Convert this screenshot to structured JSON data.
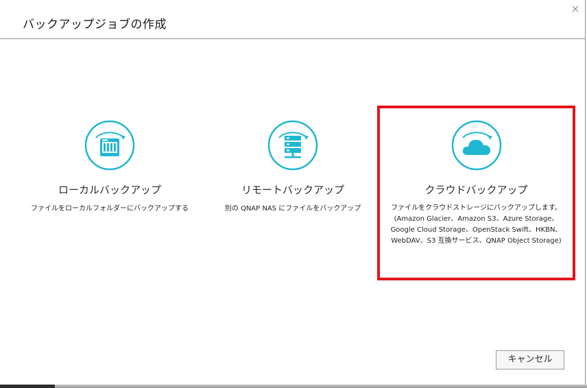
{
  "dialog": {
    "title": "バックアップジョブの作成",
    "close_icon": "close-icon"
  },
  "options": [
    {
      "id": "local",
      "icon": "nas-device-icon",
      "label": "ローカルバックアップ",
      "description": "ファイルをローカルフォルダーにバックアップする"
    },
    {
      "id": "remote",
      "icon": "server-rack-icon",
      "label": "リモートバックアップ",
      "description": "別の QNAP NAS にファイルをバックアップ"
    },
    {
      "id": "cloud",
      "icon": "cloud-icon",
      "label": "クラウドバックアップ",
      "description": "ファイルをクラウドストレージにバックアップします。(Amazon Glacier、Amazon S3、Azure Storage、Google Cloud Storage、OpenStack Swift、HKBN、WebDAV、S3 互換サービス、QNAP Object Storage)",
      "selected": true
    }
  ],
  "footer": {
    "cancel_label": "キャンセル"
  },
  "colors": {
    "accent": "#1fb7d2",
    "highlight": "#e3141b"
  }
}
